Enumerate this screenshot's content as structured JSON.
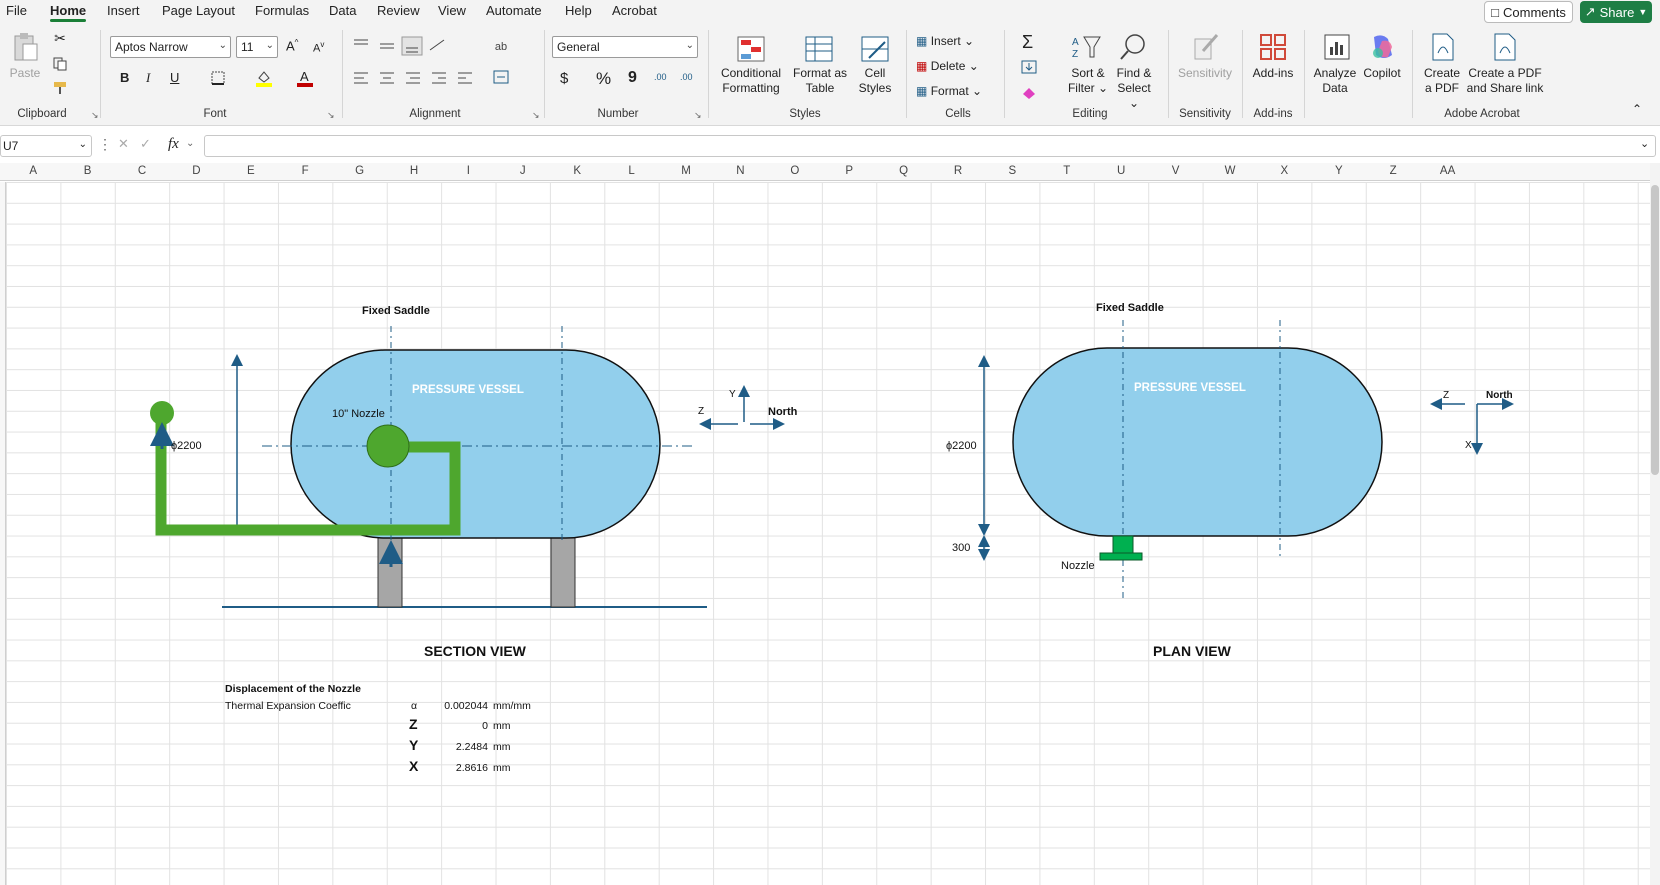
{
  "menu": {
    "items": [
      "File",
      "Home",
      "Insert",
      "Page Layout",
      "Formulas",
      "Data",
      "Review",
      "View",
      "Automate",
      "Help",
      "Acrobat"
    ],
    "active": "Home",
    "comments_label": "Comments",
    "share_label": "Share"
  },
  "ribbon": {
    "clipboard": {
      "paste": "Paste",
      "label": "Clipboard"
    },
    "font": {
      "name": "Aptos Narrow",
      "size": "11",
      "bold": "B",
      "italic": "I",
      "underline": "U",
      "label": "Font"
    },
    "alignment": {
      "label": "Alignment"
    },
    "number": {
      "format": "General",
      "currency": "$",
      "percent": "%",
      "comma": "9",
      "inc_decimal": ".00",
      "dec_decimal": ".00",
      "label": "Number"
    },
    "styles": {
      "conditional": [
        "Conditional",
        "Formatting"
      ],
      "format_table": [
        "Format as",
        "Table"
      ],
      "cell_styles": [
        "Cell",
        "Styles"
      ],
      "label": "Styles"
    },
    "cells": {
      "insert": "Insert",
      "delete": "Delete",
      "format": "Format",
      "label": "Cells"
    },
    "editing": {
      "sort": [
        "Sort &",
        "Filter"
      ],
      "find": [
        "Find &",
        "Select"
      ],
      "label": "Editing"
    },
    "sensitivity": {
      "button": "Sensitivity",
      "label": "Sensitivity"
    },
    "addins": {
      "button": "Add-ins",
      "label": "Add-ins"
    },
    "analyze": [
      "Analyze",
      "Data"
    ],
    "copilot": "Copilot",
    "acrobat": {
      "create_pdf": [
        "Create",
        "a PDF"
      ],
      "create_share": [
        "Create a PDF",
        "and Share link"
      ],
      "label": "Adobe Acrobat"
    }
  },
  "formula_bar": {
    "name_box": "U7",
    "fx": "fx",
    "content": ""
  },
  "columns": [
    "A",
    "B",
    "C",
    "D",
    "E",
    "F",
    "G",
    "H",
    "I",
    "J",
    "K",
    "L",
    "M",
    "N",
    "O",
    "P",
    "Q",
    "R",
    "S",
    "T",
    "U",
    "V",
    "W",
    "X",
    "Y",
    "Z",
    "AA"
  ],
  "section_view": {
    "title": "SECTION VIEW",
    "fixed_saddle": "Fixed Saddle",
    "vessel_label": "PRESSURE VESSEL",
    "nozzle_label": "10\" Nozzle",
    "diameter": "ϕ2200",
    "axis_y": "Y",
    "axis_z": "Z",
    "north": "North"
  },
  "plan_view": {
    "title": "PLAN VIEW",
    "fixed_saddle": "Fixed Saddle",
    "vessel_label": "PRESSURE VESSEL",
    "diameter": "ϕ2200",
    "offset": "300",
    "nozzle": "Nozzle",
    "axis_z": "Z",
    "axis_x": "X",
    "north": "North"
  },
  "displacement": {
    "heading": "Displacement of the Nozzle",
    "coeff_label": "Thermal Expansion Coeffic",
    "alpha_symbol": "α",
    "alpha_value": "0.002044",
    "alpha_unit": "mm/mm",
    "rows": [
      {
        "axis": "Z",
        "value": "0",
        "unit": "mm"
      },
      {
        "axis": "Y",
        "value": "2.2484",
        "unit": "mm"
      },
      {
        "axis": "X",
        "value": "2.8616",
        "unit": "mm"
      }
    ]
  },
  "colors": {
    "vessel_fill": "#92cfec",
    "pipe_green": "#4ea72e",
    "axis_blue": "#1f5c86",
    "saddle_gray": "#a6a6a6",
    "nozzle_green": "#00b050",
    "share_green": "#1e7e45"
  }
}
